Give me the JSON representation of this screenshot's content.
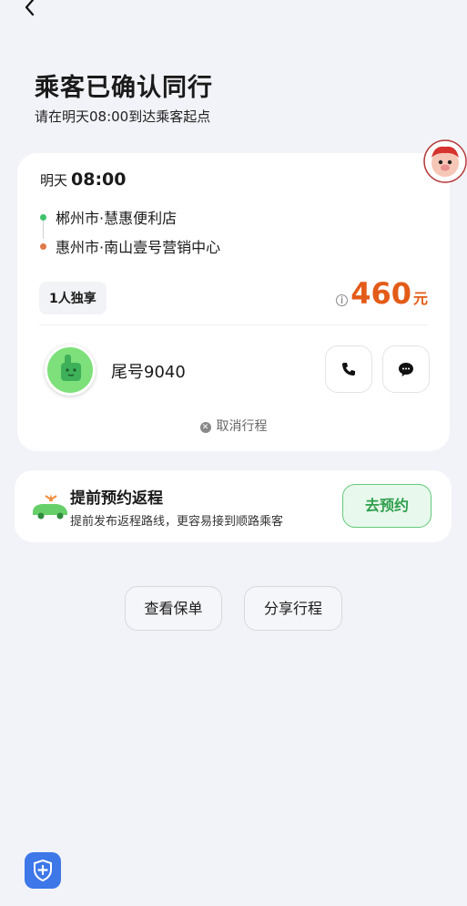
{
  "header": {
    "title": "乘客已确认同行",
    "subtitle": "请在明天08:00到达乘客起点"
  },
  "trip": {
    "day": "明天",
    "time": "08:00",
    "start": "郴州市·慧惠便利店",
    "end": "惠州市·南山壹号营销中心",
    "ride_type": "1人独享",
    "price": "460",
    "price_unit": "元",
    "plate": "尾号9040",
    "cancel_label": "取消行程"
  },
  "return_trip": {
    "title": "提前预约返程",
    "desc": "提前发布返程路线，更容易接到顺路乘客",
    "button": "去预约"
  },
  "actions": {
    "policy": "查看保单",
    "share": "分享行程"
  },
  "colors": {
    "accent_green": "#2f9f4c",
    "price_orange": "#e35b18",
    "shield_blue": "#3d77e8"
  },
  "icons": [
    "back-icon",
    "passenger-avatar",
    "phone-icon",
    "chat-icon",
    "close-icon",
    "car-icon",
    "shield-icon"
  ]
}
